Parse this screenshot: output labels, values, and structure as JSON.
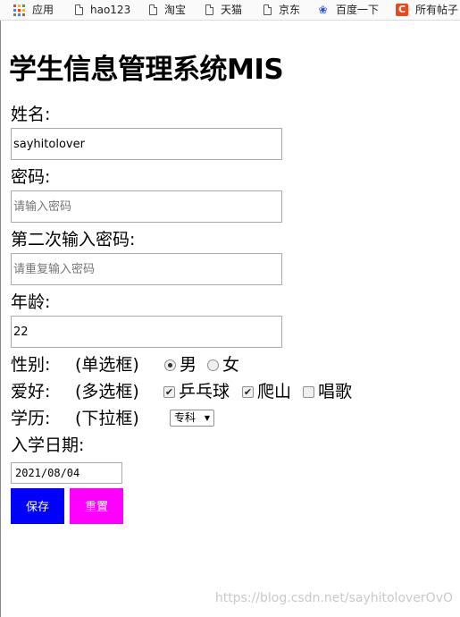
{
  "bookmarks": [
    {
      "label": "应用",
      "icon": "apps-grid-icon"
    },
    {
      "label": "hao123",
      "icon": "page-icon"
    },
    {
      "label": "淘宝",
      "icon": "page-icon"
    },
    {
      "label": "天猫",
      "icon": "page-icon"
    },
    {
      "label": "京东",
      "icon": "page-icon"
    },
    {
      "label": "百度一下",
      "icon": "baidu-paw-icon"
    },
    {
      "label": "所有帖子",
      "icon": "csdn-c-icon"
    }
  ],
  "page": {
    "title": "学生信息管理系统MIS"
  },
  "form": {
    "name": {
      "label": "姓名:",
      "value": "sayhitolover"
    },
    "password": {
      "label": "密码:",
      "placeholder": "请输入密码"
    },
    "password2": {
      "label": "第二次输入密码:",
      "placeholder": "请重复输入密码"
    },
    "age": {
      "label": "年龄:",
      "value": "22"
    },
    "gender": {
      "label": "性别:",
      "hint": "(单选框)",
      "options": [
        "男",
        "女"
      ],
      "selected": "男"
    },
    "hobby": {
      "label": "爱好:",
      "hint": "(多选框)",
      "options": [
        {
          "label": "乒乓球",
          "checked": true
        },
        {
          "label": "爬山",
          "checked": true
        },
        {
          "label": "唱歌",
          "checked": false
        }
      ]
    },
    "education": {
      "label": "学历:",
      "hint": "(下拉框)",
      "selected": "专科"
    },
    "enroll_date": {
      "label": "入学日期:",
      "value": "2021/08/04"
    },
    "save_label": "保存",
    "reset_label": "重置"
  },
  "colors": {
    "save_bg": "#0000ff",
    "reset_bg": "#ff00ff"
  },
  "watermark": "https://blog.csdn.net/sayhitoloverOvO"
}
